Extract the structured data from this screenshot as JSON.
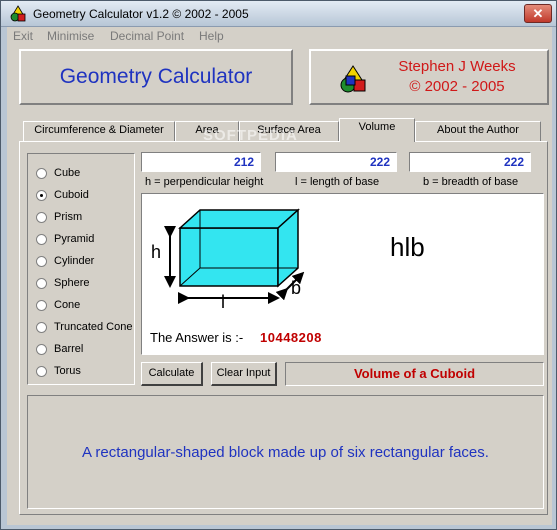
{
  "window": {
    "title": "Geometry Calculator v1.2 ©  2002 - 2005",
    "close_glyph": "✕"
  },
  "menu": [
    "Exit",
    "Minimise",
    "Decimal Point",
    "Help"
  ],
  "header": {
    "app_title": "Geometry Calculator",
    "author": "Stephen J Weeks",
    "years": "© 2002 - 2005"
  },
  "tabs": [
    {
      "label": "Circumference & Diameter"
    },
    {
      "label": "Area"
    },
    {
      "label": "Surface Area"
    },
    {
      "label": "Volume",
      "active": true
    },
    {
      "label": "About the Author"
    }
  ],
  "shapes": [
    {
      "label": "Cube",
      "checked": false
    },
    {
      "label": "Cuboid",
      "checked": true
    },
    {
      "label": "Prism",
      "checked": false
    },
    {
      "label": "Pyramid",
      "checked": false
    },
    {
      "label": "Cylinder",
      "checked": false
    },
    {
      "label": "Sphere",
      "checked": false
    },
    {
      "label": "Cone",
      "checked": false
    },
    {
      "label": "Truncated Cone",
      "checked": false
    },
    {
      "label": "Barrel",
      "checked": false
    },
    {
      "label": "Torus",
      "checked": false
    }
  ],
  "inputs": {
    "height": {
      "value": "212",
      "caption": "h = perpendicular height"
    },
    "length": {
      "value": "222",
      "caption": "l = length of base"
    },
    "breadth": {
      "value": "222",
      "caption": "b = breadth of base"
    }
  },
  "diagram": {
    "h_label": "h",
    "l_label": "l",
    "b_label": "b",
    "formula": "hlb",
    "fill_color": "#33e5f0"
  },
  "answer": {
    "label": "The Answer is :-",
    "value": "10448208"
  },
  "buttons": {
    "calculate": "Calculate",
    "clear": "Clear Input"
  },
  "result_title": "Volume of a Cuboid",
  "description": "A rectangular-shaped block made up of six rectangular faces.",
  "watermark": "SOFTPEDIA"
}
